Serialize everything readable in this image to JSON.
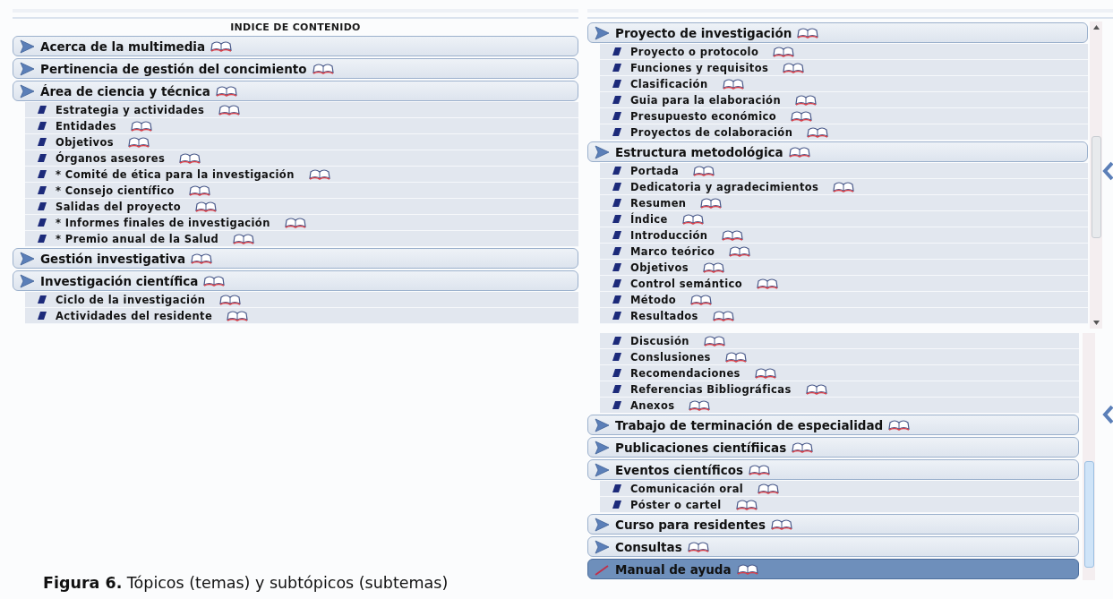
{
  "left_panel": {
    "heading": "INDICE DE CONTENIDO",
    "topics": [
      {
        "label": "Acerca de la multimedia",
        "selected": false
      },
      {
        "label": "Pertinencia de gestión del concimiento",
        "selected": false
      },
      {
        "label": "Área de ciencia y técnica",
        "selected": false,
        "children": [
          "Estrategia y actividades",
          "Entidades",
          "Objetivos",
          "Órganos asesores",
          "* Comité de ética para la investigación",
          "* Consejo científico",
          "Salidas del proyecto",
          "* Informes finales de investigación",
          "* Premio anual de la Salud"
        ]
      },
      {
        "label": "Gestión investigativa",
        "selected": false
      },
      {
        "label": "Investigación científica",
        "selected": false,
        "children": [
          "Ciclo de la investigación",
          "Actividades del residente"
        ]
      }
    ]
  },
  "right_top_panel": {
    "topics": [
      {
        "label": "Proyecto de investigación",
        "selected": false,
        "children": [
          "Proyecto o protocolo",
          "Funciones y requisitos",
          "Clasificación",
          "Guia para la elaboración",
          "Presupuesto económico",
          "Proyectos de colaboración"
        ]
      },
      {
        "label": "Estructura metodológica",
        "selected": false,
        "children": [
          "Portada",
          "Dedicatoria y agradecimientos",
          "Resumen",
          "Índice",
          "Introducción",
          "Marco teórico",
          "Objetivos",
          "Control semántico",
          "Método",
          "Resultados"
        ]
      }
    ]
  },
  "right_bottom_panel": {
    "continued_items": [
      "Discusión",
      "Conslusiones",
      "Recomendaciones",
      "Referencias Bibliográficas",
      "Anexos"
    ],
    "topics": [
      {
        "label": "Trabajo de terminación de especialidad",
        "selected": false
      },
      {
        "label": "Publicaciones científiicas",
        "selected": false
      },
      {
        "label": "Eventos científicos",
        "selected": false,
        "children": [
          "Comunicación oral",
          "Póster o cartel"
        ]
      },
      {
        "label": "Curso para residentes",
        "selected": false
      },
      {
        "label": "Consultas",
        "selected": false
      },
      {
        "label": "Manual de ayuda",
        "selected": true
      }
    ]
  },
  "caption": "**Figura 6.** Tópicos (temas) y subtópicos (subtemas)"
}
